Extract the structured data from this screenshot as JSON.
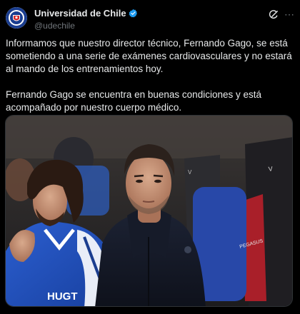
{
  "account": {
    "display_name": "Universidad de Chile",
    "handle": "@udechile"
  },
  "post": {
    "paragraphs": [
      "Informamos que nuestro director técnico, Fernando Gago, se está sometiendo a una serie de exámenes cardiovasculares y no estará al mando de los entrenamientos hoy.",
      "Fernando Gago se encuentra en buenas condiciones y está acompañado por nuestro cuerpo médico."
    ]
  },
  "icons": {
    "verified": "verified-badge-icon",
    "grok": "grok-icon",
    "more": "more-icon"
  },
  "photo_text": {
    "shirt_brand": "PEGASUS",
    "jersey_sponsor": "HUGT"
  },
  "colors": {
    "background": "#000000",
    "text": "#e7e9ea",
    "muted": "#71767b",
    "verified": "#1d9bf0"
  }
}
